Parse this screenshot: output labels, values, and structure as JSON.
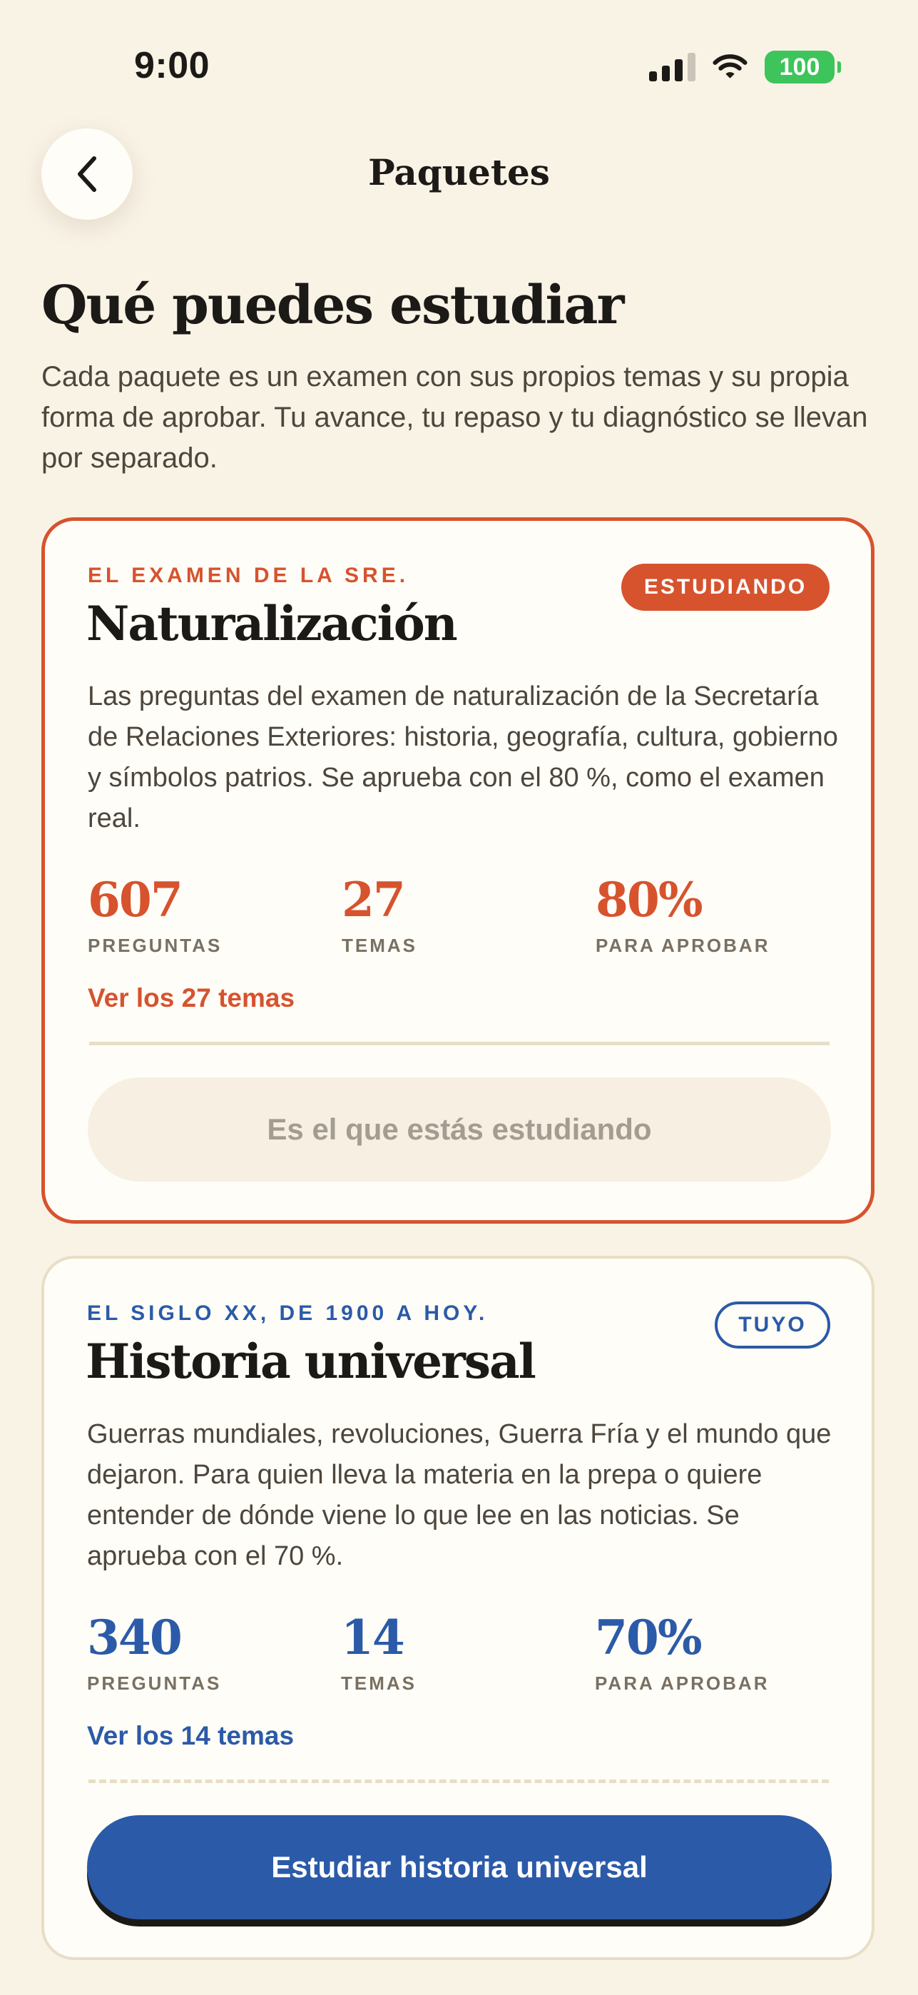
{
  "status_bar": {
    "time": "9:00",
    "battery": "100"
  },
  "header": {
    "title": "Paquetes",
    "back_icon": "chevron-left-icon"
  },
  "intro": {
    "title": "Qué puedes estudiar",
    "subtitle": "Cada paquete es un examen con sus propios temas y su propia forma de aprobar. Tu avance, tu repaso y tu diagnóstico se llevan por separado."
  },
  "colors": {
    "background": "#f9f3e6",
    "accent_orange": "#d6532e",
    "accent_blue": "#2b5aa8",
    "card": "#fffdf7"
  },
  "packages": [
    {
      "kicker": "EL EXAMEN DE LA SRE.",
      "badge": "ESTUDIANDO",
      "title": "Naturalización",
      "description": "Las preguntas del examen de naturalización de la Secretaría de Relaciones Exteriores: historia, geografía, cultura, gobierno y símbolos patrios. Se aprueba con el 80 %, como el examen real.",
      "stats": [
        {
          "value": "607",
          "label": "PREGUNTAS"
        },
        {
          "value": "27",
          "label": "TEMAS"
        },
        {
          "value": "80%",
          "label": "PARA APROBAR"
        }
      ],
      "link": "Ver los 27 temas",
      "button": "Es el que estás estudiando"
    },
    {
      "kicker": "EL SIGLO XX, DE 1900 A HOY.",
      "badge": "TUYO",
      "title": "Historia universal",
      "description": "Guerras mundiales, revoluciones, Guerra Fría y el mundo que dejaron. Para quien lleva la materia en la prepa o quiere entender de dónde viene lo que lee en las noticias. Se aprueba con el 70 %.",
      "stats": [
        {
          "value": "340",
          "label": "PREGUNTAS"
        },
        {
          "value": "14",
          "label": "TEMAS"
        },
        {
          "value": "70%",
          "label": "PARA APROBAR"
        }
      ],
      "link": "Ver los 14 temas",
      "button": "Estudiar historia universal"
    }
  ]
}
